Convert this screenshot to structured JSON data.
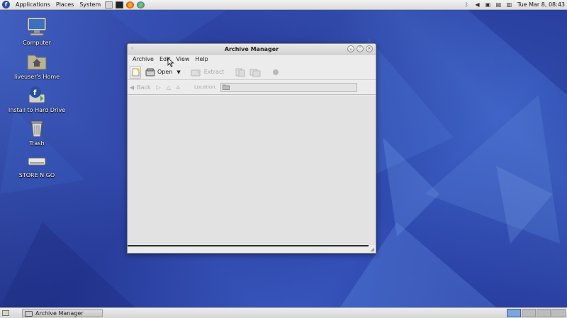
{
  "top_panel": {
    "menus": [
      "Applications",
      "Places",
      "System"
    ],
    "clock": "Tue Mar  8, 08:43"
  },
  "desktop": {
    "icons": [
      {
        "label": "Computer",
        "icon": "computer-icon"
      },
      {
        "label": "liveuser's Home",
        "icon": "home-folder-icon"
      },
      {
        "label": "Install to Hard Drive",
        "icon": "install-icon"
      },
      {
        "label": "Trash",
        "icon": "trash-icon"
      },
      {
        "label": "STORE N GO",
        "icon": "drive-icon"
      }
    ]
  },
  "window": {
    "title": "Archive Manager",
    "menu": [
      "Archive",
      "Edit",
      "View",
      "Help"
    ],
    "toolbar": {
      "open_label": "Open",
      "extract_label": "Extract"
    },
    "locationbar": {
      "back_label": "Back",
      "location_label": "Location:",
      "location_value": ""
    }
  },
  "bottom_panel": {
    "task_label": "Archive Manager",
    "workspaces": 4,
    "active_workspace": 1
  },
  "colors": {
    "wallpaper": "#2c3f9a",
    "workspace_active": "#7fa4d6"
  }
}
